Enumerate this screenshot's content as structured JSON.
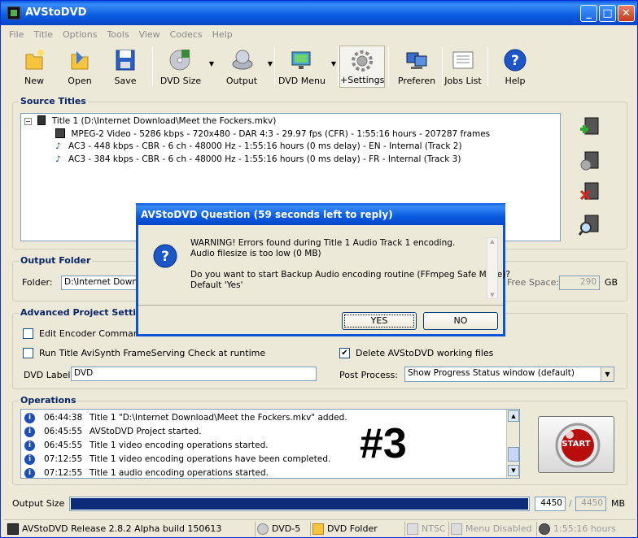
{
  "window": {
    "title": "AVStoDVD"
  },
  "menu": [
    "File",
    "Title",
    "Options",
    "Tools",
    "View",
    "Codecs",
    "Help"
  ],
  "toolbar": {
    "new": "New",
    "open": "Open",
    "save": "Save",
    "dvd_size": "DVD Size",
    "output": "Output",
    "dvd_menu": "DVD Menu",
    "settings": "+Settings",
    "preferences": "Preferen",
    "jobs_list": "Jobs List",
    "help": "Help"
  },
  "source": {
    "label": "Source Titles",
    "title_row": "Title 1 (D:\\Internet Download\\Meet the Fockers.mkv)",
    "video_row": "MPEG-2 Video - 5286 kbps - 720x480 - DAR 4:3 - 29.97 fps (CFR) - 1:55:16 hours - 207287 frames",
    "audio1_row": "AC3 - 448 kbps - CBR - 6 ch - 48000 Hz - 1:55:16 hours (0 ms delay) - EN - Internal (Track 2)",
    "audio2_row": "AC3 - 384 kbps - CBR - 6 ch - 48000 Hz - 1:55:16 hours (0 ms delay) - FR - Internal (Track 3)"
  },
  "output_folder": {
    "label": "Output Folder",
    "folder_label": "Folder:",
    "folder_value": "D:\\Internet Downlo",
    "free_space_label": "Free Space:",
    "free_space_value": "290",
    "free_space_unit": "GB"
  },
  "advanced": {
    "label": "Advanced Project Setting",
    "edit_encoder": "Edit Encoder Command P",
    "run_avisynth": "Run Title AviSynth FrameServing Check at runtime",
    "delete_working": "Delete AVStoDVD working files",
    "delete_checked": "✔",
    "dvd_label_label": "DVD Label:",
    "dvd_label_value": "DVD",
    "post_process_label": "Post Process:",
    "post_process_value": "Show Progress Status window (default)"
  },
  "operations": {
    "label": "Operations",
    "rows": [
      {
        "time": "06:44:38",
        "text": "Title 1 \"D:\\Internet Download\\Meet the Fockers.mkv\" added."
      },
      {
        "time": "06:45:55",
        "text": "AVStoDVD Project started."
      },
      {
        "time": "06:45:55",
        "text": "Title 1 video encoding operations started."
      },
      {
        "time": "07:12:55",
        "text": "Title 1 video encoding operations have been completed."
      },
      {
        "time": "07:12:55",
        "text": "Title 1 audio encoding operations started."
      }
    ],
    "overlay": "#3",
    "start_label": "START"
  },
  "output_size": {
    "label": "Output Size",
    "value": "4450",
    "separator": "/",
    "max": "4450",
    "unit": "MB",
    "progress_fraction": 1.0
  },
  "status": {
    "release": "AVStoDVD Release 2.8.2 Alpha build 150613",
    "disc": "DVD-5",
    "output_type": "DVD Folder",
    "format": "NTSC",
    "menu": "Menu Disabled",
    "duration": "1:55:16 hours"
  },
  "dialog": {
    "title": "AVStoDVD Question (59 seconds left to reply)",
    "line1": "WARNING! Errors found during Title 1 Audio Track 1 encoding.",
    "line2": "Audio filesize is too low (0 MB)",
    "line3": "Do you want to start Backup Audio encoding routine (FFmpeg Safe Mode)?",
    "line4": "Default 'Yes'",
    "yes": "YES",
    "no": "NO"
  },
  "colors": {
    "title_blue": "#0a5ce0",
    "group_label": "#0a246a",
    "progress": "#0b2a7a",
    "close_red": "#c43a1a"
  }
}
